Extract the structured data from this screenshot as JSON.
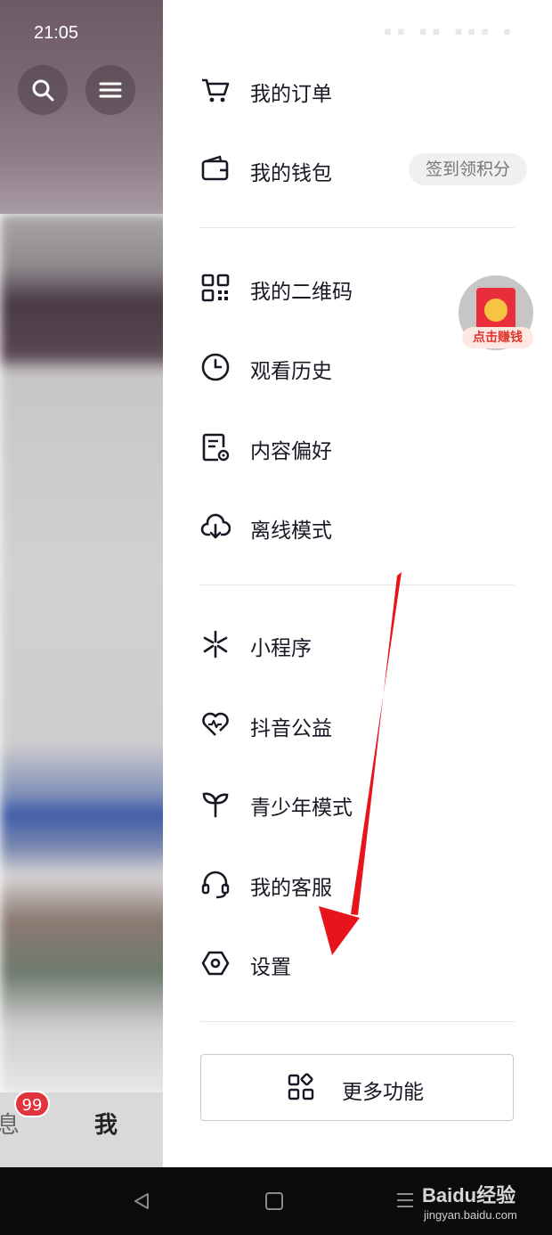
{
  "status_bar": {
    "time": "21:05"
  },
  "background": {
    "tab_partial": "息",
    "tab_me": "我",
    "message_badge": "99"
  },
  "drawer": {
    "section1": [
      {
        "label": "我的订单",
        "icon": "cart-icon"
      },
      {
        "label": "我的钱包",
        "icon": "wallet-icon",
        "pill": "签到领积分"
      }
    ],
    "section2": [
      {
        "label": "我的二维码",
        "icon": "qrcode-icon"
      },
      {
        "label": "观看历史",
        "icon": "clock-icon"
      },
      {
        "label": "内容偏好",
        "icon": "document-settings-icon"
      },
      {
        "label": "离线模式",
        "icon": "cloud-download-icon"
      }
    ],
    "section3": [
      {
        "label": "小程序",
        "icon": "mini-program-icon"
      },
      {
        "label": "抖音公益",
        "icon": "heart-charity-icon"
      },
      {
        "label": "青少年模式",
        "icon": "sprout-icon"
      },
      {
        "label": "我的客服",
        "icon": "headset-icon"
      },
      {
        "label": "设置",
        "icon": "settings-hexagon-icon"
      }
    ],
    "more_button": "更多功能"
  },
  "floating_reward": {
    "label": "点击赚钱"
  },
  "watermark": {
    "brand": "Baidu经验",
    "url": "jingyan.baidu.com"
  },
  "colors": {
    "accent_red": "#e2343d",
    "arrow_red": "#e8141c",
    "text": "#161823"
  }
}
